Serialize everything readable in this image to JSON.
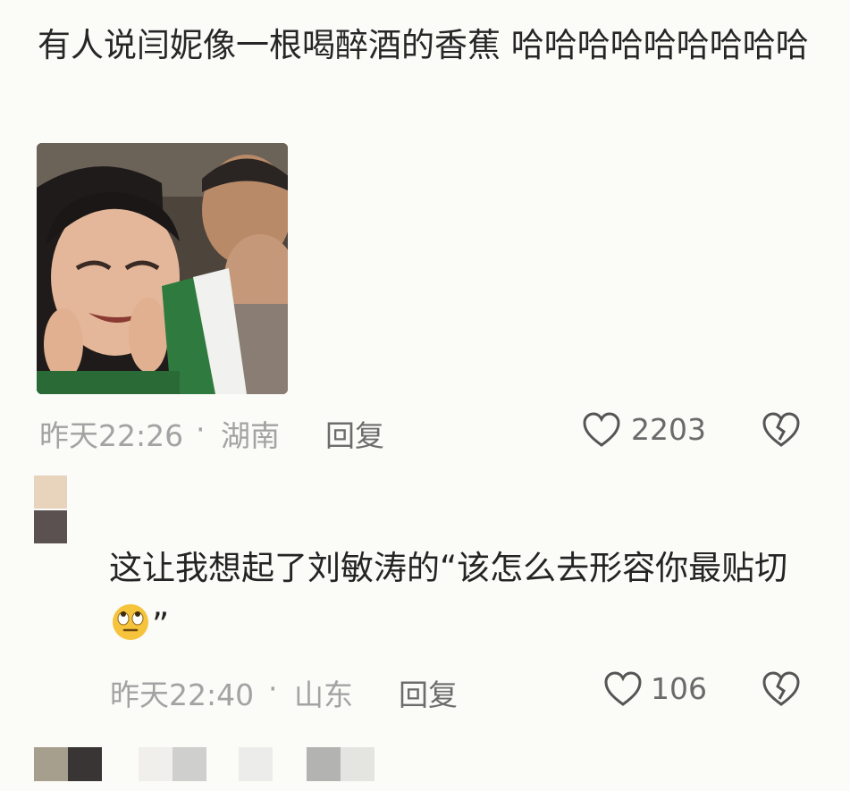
{
  "comments": [
    {
      "text": "有人说闫妮像一根喝醉酒的香蕉  哈哈哈哈哈哈哈哈哈",
      "time": "昨天22:26",
      "separator": "·",
      "location": "湖南",
      "reply_label": "回复",
      "likes": "2203"
    },
    {
      "text_main": "这让我想起了刘敏涛的“该怎么去形容你最贴切",
      "emoji": "eye-roll-emoji",
      "text_end": "”",
      "time": "昨天22:40",
      "separator": "·",
      "location": "山东",
      "reply_label": "回复",
      "likes": "106"
    }
  ],
  "icons": {
    "like": "heart-outline-icon",
    "dislike": "broken-heart-icon"
  },
  "colors": {
    "background": "#fbfbf8",
    "text": "#262626",
    "meta": "#a3a3a3"
  }
}
